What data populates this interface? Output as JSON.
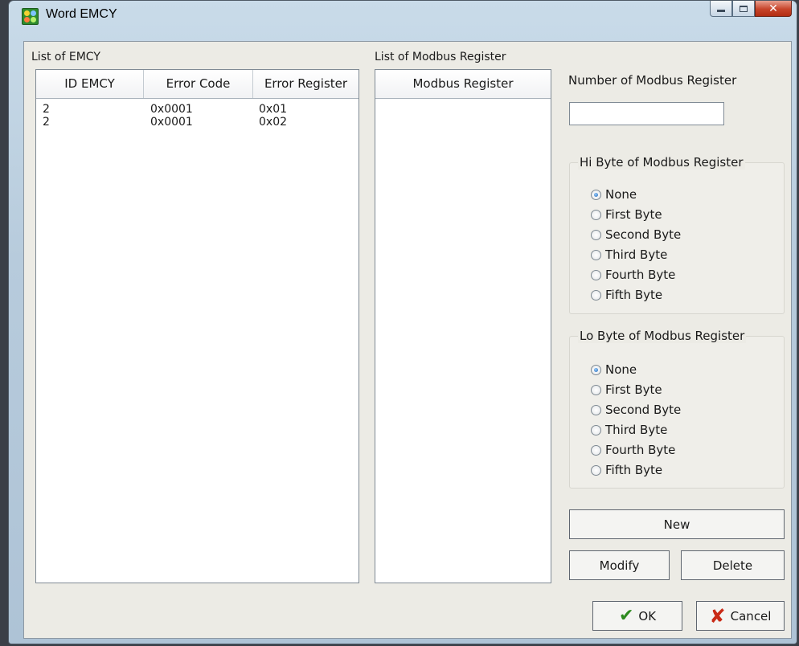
{
  "window": {
    "title": "Word EMCY"
  },
  "emcy_list": {
    "title": "List of EMCY",
    "columns": [
      "ID EMCY",
      "Error Code",
      "Error Register"
    ],
    "rows": [
      [
        "2",
        "0x0001",
        "0x01"
      ],
      [
        "2",
        "0x0001",
        "0x02"
      ]
    ]
  },
  "modbus_list": {
    "title": "List of Modbus Register",
    "columns": [
      "Modbus Register"
    ]
  },
  "number_of_register": {
    "label": "Number of Modbus Register",
    "value": ""
  },
  "hi_byte": {
    "title": "Hi Byte of Modbus Register",
    "options": [
      "None",
      "First Byte",
      "Second Byte",
      "Third Byte",
      "Fourth Byte",
      "Fifth Byte"
    ],
    "selected": "None"
  },
  "lo_byte": {
    "title": "Lo Byte of Modbus Register",
    "options": [
      "None",
      "First Byte",
      "Second Byte",
      "Third Byte",
      "Fourth Byte",
      "Fifth Byte"
    ],
    "selected": "None"
  },
  "buttons": {
    "new": "New",
    "modify": "Modify",
    "delete": "Delete",
    "ok": "OK",
    "cancel": "Cancel"
  },
  "icons": {
    "ok": "check-icon",
    "cancel": "cross-icon"
  },
  "colors": {
    "ok_check": "#2d8a1f",
    "cancel_x": "#c92a16",
    "close_button": "#c7442a"
  }
}
